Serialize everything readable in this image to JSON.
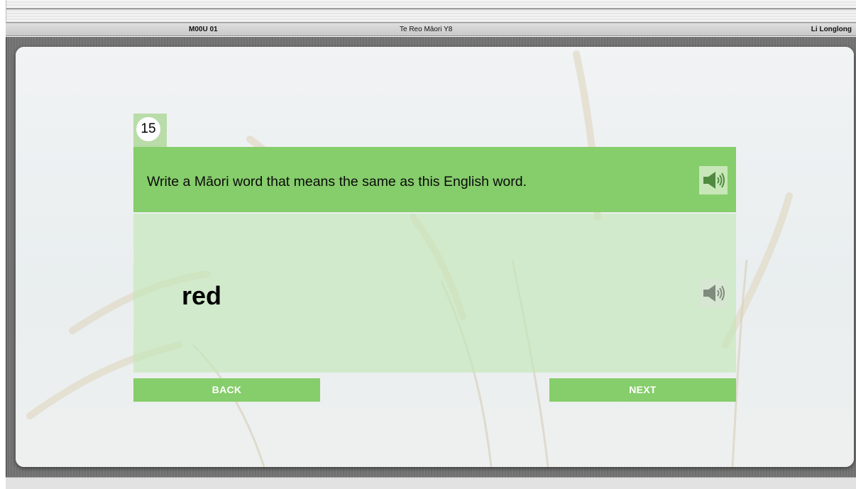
{
  "header": {
    "code": "M00U 01",
    "course": "Te Reo Māori Y8",
    "user": "Li Longlong"
  },
  "question": {
    "number": "15",
    "prompt": "Write a Māori word that means the same as this English word.",
    "word": "red",
    "prompt_audio_icon": "speaker-icon",
    "word_audio_icon": "speaker-icon"
  },
  "nav": {
    "back_label": "BACK",
    "next_label": "NEXT"
  },
  "colors": {
    "accent_green": "#86cd6b",
    "light_green": "#c4e6b6",
    "frame_grey": "#747474"
  }
}
